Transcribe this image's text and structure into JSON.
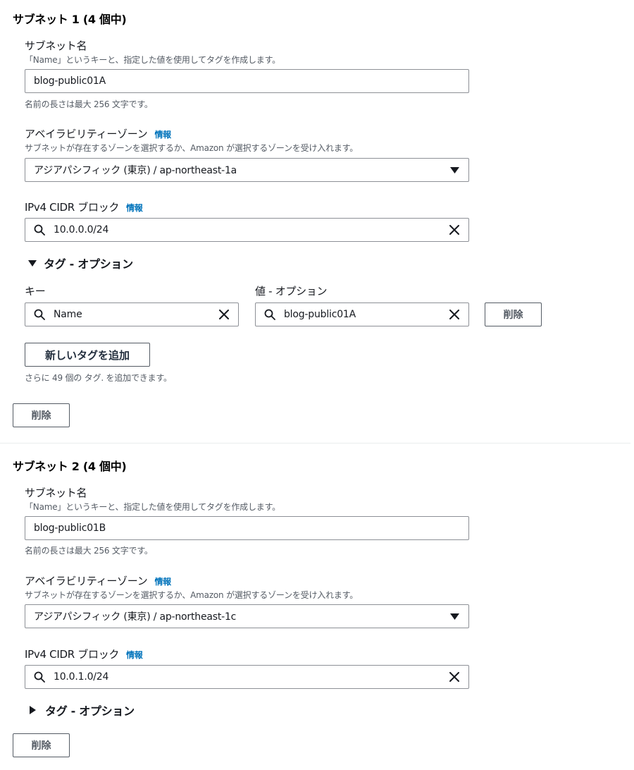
{
  "subnets": [
    {
      "title": "サブネット 1 (4 個中)",
      "name_label": "サブネット名",
      "name_desc": "「Name」というキーと、指定した値を使用してタグを作成します。",
      "name_value": "blog-public01A",
      "name_hint": "名前の長さは最大 256 文字です。",
      "az_label": "アベイラビリティーゾーン",
      "az_info": "情報",
      "az_desc": "サブネットが存在するゾーンを選択するか、Amazon が選択するゾーンを受け入れます。",
      "az_value": "アジアパシフィック (東京) / ap-northeast-1a",
      "cidr_label": "IPv4 CIDR ブロック",
      "cidr_info": "情報",
      "cidr_value": "10.0.0.0/24",
      "tags_toggle": "タグ - オプション",
      "tags_expanded": true,
      "tag_key_label": "キー",
      "tag_value_label": "値 - オプション",
      "tag_key": "Name",
      "tag_value": "blog-public01A",
      "tag_remove_label": "削除",
      "add_tag_label": "新しいタグを追加",
      "tag_remaining": "さらに 49 個の タグ. を追加できます。",
      "remove_label": "削除"
    },
    {
      "title": "サブネット 2 (4 個中)",
      "name_label": "サブネット名",
      "name_desc": "「Name」というキーと、指定した値を使用してタグを作成します。",
      "name_value": "blog-public01B",
      "name_hint": "名前の長さは最大 256 文字です。",
      "az_label": "アベイラビリティーゾーン",
      "az_info": "情報",
      "az_desc": "サブネットが存在するゾーンを選択するか、Amazon が選択するゾーンを受け入れます。",
      "az_value": "アジアパシフィック (東京) / ap-northeast-1c",
      "cidr_label": "IPv4 CIDR ブロック",
      "cidr_info": "情報",
      "cidr_value": "10.0.1.0/24",
      "tags_toggle": "タグ - オプション",
      "tags_expanded": false,
      "remove_label": "削除"
    }
  ],
  "icons": {
    "search": "search-icon",
    "clear": "close-icon",
    "dropdown": "caret-down-icon",
    "expanded": "caret-down-icon",
    "collapsed": "caret-right-icon"
  },
  "colors": {
    "link": "#0073bb",
    "text": "#16191f",
    "muted": "#545b64",
    "border": "#8d9096"
  }
}
